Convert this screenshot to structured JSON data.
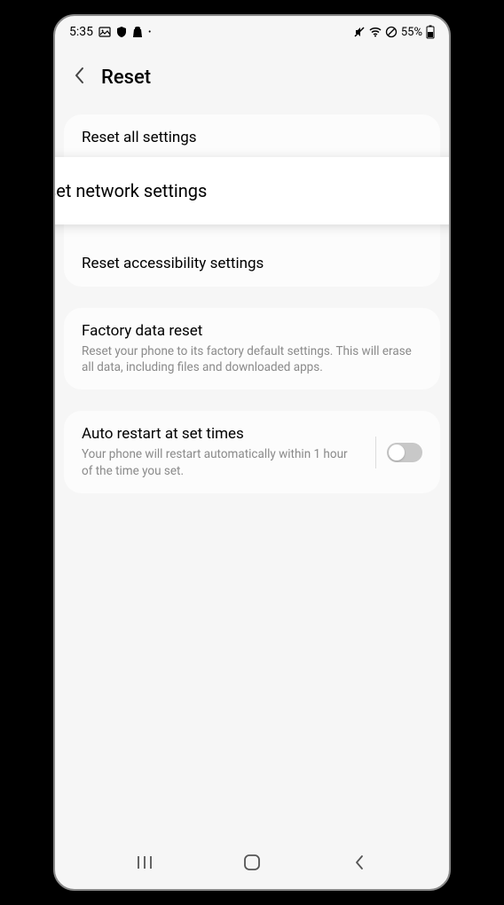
{
  "statusBar": {
    "time": "5:35",
    "batteryPercent": "55%"
  },
  "header": {
    "title": "Reset"
  },
  "items": {
    "resetAll": {
      "title": "Reset all settings"
    },
    "resetNetwork": {
      "title": "Reset network settings"
    },
    "resetAccessibility": {
      "title": "Reset accessibility settings"
    },
    "factoryReset": {
      "title": "Factory data reset",
      "desc": "Reset your phone to its factory default settings. This will erase all data, including files and downloaded apps."
    },
    "autoRestart": {
      "title": "Auto restart at set times",
      "desc": "Your phone will restart automatically within 1 hour of the time you set.",
      "toggled": false
    }
  }
}
